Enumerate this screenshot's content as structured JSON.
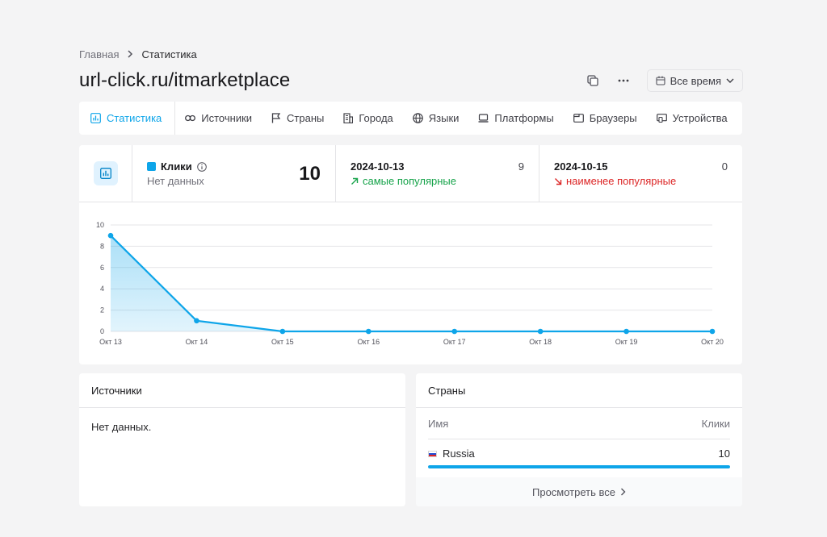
{
  "breadcrumb": {
    "home": "Главная",
    "current": "Статистика"
  },
  "page_title": "url-click.ru/itmarketplace",
  "actions": {
    "period_label": "Все время"
  },
  "tabs": [
    {
      "label": "Статистика",
      "icon": "bar-chart-icon",
      "active": true
    },
    {
      "label": "Источники",
      "icon": "link-icon"
    },
    {
      "label": "Страны",
      "icon": "flag-icon"
    },
    {
      "label": "Города",
      "icon": "building-icon"
    },
    {
      "label": "Языки",
      "icon": "globe-icon"
    },
    {
      "label": "Платформы",
      "icon": "laptop-icon"
    },
    {
      "label": "Браузеры",
      "icon": "browser-icon"
    },
    {
      "label": "Устройства",
      "icon": "devices-icon"
    }
  ],
  "stats": {
    "metric_label": "Клики",
    "metric_sub": "Нет данных",
    "metric_value": "10",
    "popular": {
      "date": "2024-10-13",
      "count": "9",
      "label": "самые популярные"
    },
    "unpopular": {
      "date": "2024-10-15",
      "count": "0",
      "label": "наименее популярные"
    }
  },
  "colors": {
    "accent": "#0ea5e9",
    "up": "#16a34a",
    "down": "#dc2626"
  },
  "chart_data": {
    "type": "area",
    "categories": [
      "Окт 13",
      "Окт 14",
      "Окт 15",
      "Окт 16",
      "Окт 17",
      "Окт 18",
      "Окт 19",
      "Окт 20"
    ],
    "series": [
      {
        "values": [
          9,
          1,
          0,
          0,
          0,
          0,
          0,
          0
        ]
      }
    ],
    "yticks": [
      0,
      2,
      4,
      6,
      8,
      10
    ],
    "ylim": [
      0,
      10
    ],
    "grid": true,
    "title": "",
    "xlabel": "",
    "ylabel": ""
  },
  "sources_panel": {
    "title": "Источники",
    "empty": "Нет данных."
  },
  "countries_panel": {
    "title": "Страны",
    "col_name": "Имя",
    "col_clicks": "Клики",
    "rows": [
      {
        "name": "Russia",
        "clicks": "10",
        "share": 1.0
      }
    ],
    "view_all": "Просмотреть все"
  }
}
